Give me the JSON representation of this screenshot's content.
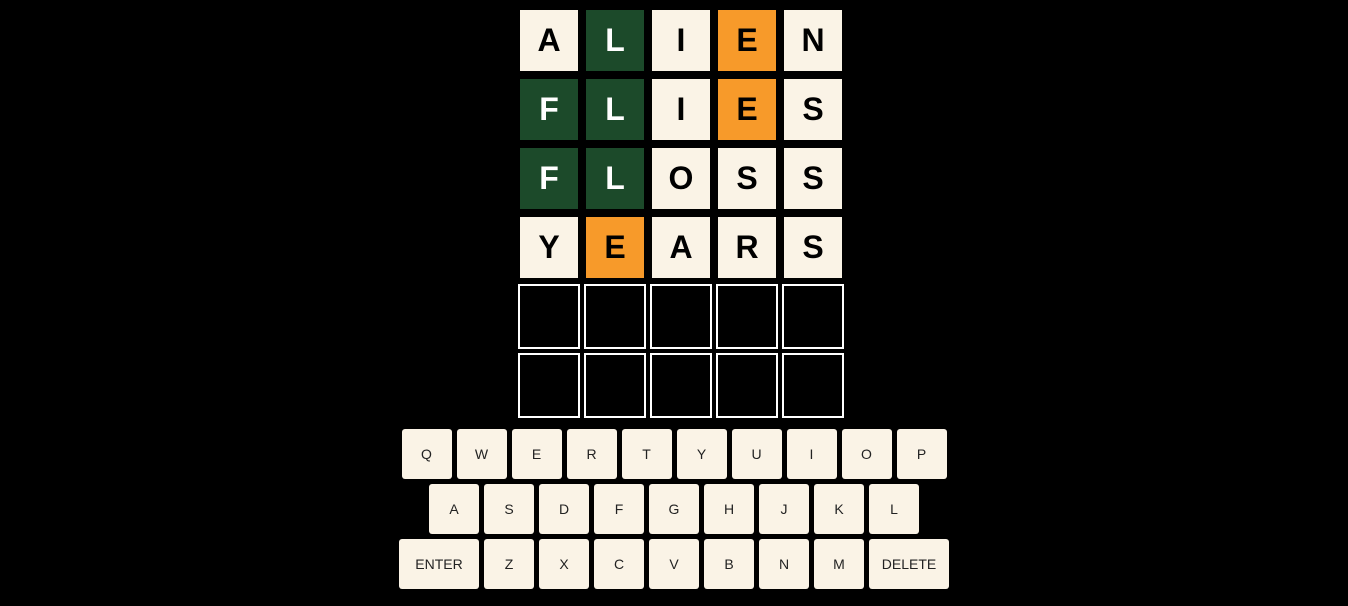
{
  "board": {
    "rows": [
      {
        "tiles": [
          {
            "letter": "A",
            "state": "absent"
          },
          {
            "letter": "L",
            "state": "correct"
          },
          {
            "letter": "I",
            "state": "absent"
          },
          {
            "letter": "E",
            "state": "present"
          },
          {
            "letter": "N",
            "state": "absent"
          }
        ]
      },
      {
        "tiles": [
          {
            "letter": "F",
            "state": "correct"
          },
          {
            "letter": "L",
            "state": "correct"
          },
          {
            "letter": "I",
            "state": "absent"
          },
          {
            "letter": "E",
            "state": "present"
          },
          {
            "letter": "S",
            "state": "absent"
          }
        ]
      },
      {
        "tiles": [
          {
            "letter": "F",
            "state": "correct"
          },
          {
            "letter": "L",
            "state": "correct"
          },
          {
            "letter": "O",
            "state": "absent"
          },
          {
            "letter": "S",
            "state": "absent"
          },
          {
            "letter": "S",
            "state": "absent"
          }
        ]
      },
      {
        "tiles": [
          {
            "letter": "Y",
            "state": "absent"
          },
          {
            "letter": "E",
            "state": "present"
          },
          {
            "letter": "A",
            "state": "absent"
          },
          {
            "letter": "R",
            "state": "absent"
          },
          {
            "letter": "S",
            "state": "absent"
          }
        ]
      },
      {
        "tiles": [
          {
            "letter": "",
            "state": "empty"
          },
          {
            "letter": "",
            "state": "empty"
          },
          {
            "letter": "",
            "state": "empty"
          },
          {
            "letter": "",
            "state": "empty"
          },
          {
            "letter": "",
            "state": "empty"
          }
        ]
      },
      {
        "tiles": [
          {
            "letter": "",
            "state": "empty"
          },
          {
            "letter": "",
            "state": "empty"
          },
          {
            "letter": "",
            "state": "empty"
          },
          {
            "letter": "",
            "state": "empty"
          },
          {
            "letter": "",
            "state": "empty"
          }
        ]
      }
    ]
  },
  "keyboard": {
    "rows": [
      [
        "Q",
        "W",
        "E",
        "R",
        "T",
        "Y",
        "U",
        "I",
        "O",
        "P"
      ],
      [
        "A",
        "S",
        "D",
        "F",
        "G",
        "H",
        "J",
        "K",
        "L"
      ],
      [
        "ENTER",
        "Z",
        "X",
        "C",
        "V",
        "B",
        "N",
        "M",
        "DELETE"
      ]
    ]
  },
  "colors": {
    "correct": "#1c4a2a",
    "present": "#f79a2a",
    "absent": "#faf3e6",
    "background": "#000000",
    "key": "#faf3e6"
  }
}
